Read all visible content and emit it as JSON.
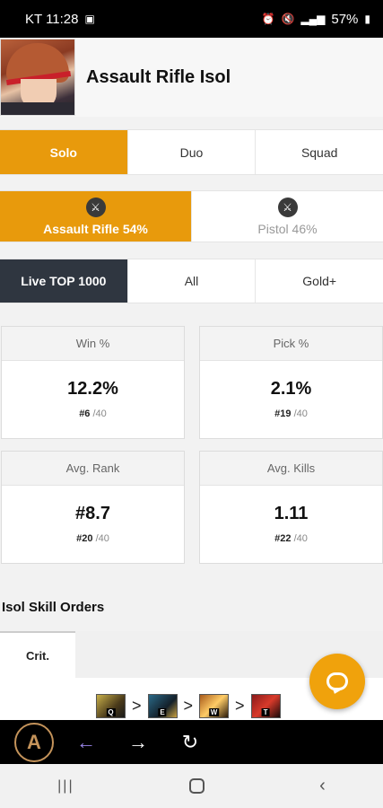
{
  "status": {
    "carrier_time": "KT 11:28",
    "battery": "57%"
  },
  "header": {
    "title": "Assault Rifle Isol"
  },
  "mode_tabs": [
    {
      "label": "Solo",
      "active": true
    },
    {
      "label": "Duo",
      "active": false
    },
    {
      "label": "Squad",
      "active": false
    }
  ],
  "weapon_tabs": [
    {
      "label": "Assault Rifle 54%",
      "icon": "assault-rifle-icon",
      "active": true
    },
    {
      "label": "Pistol 46%",
      "icon": "pistol-icon",
      "active": false
    }
  ],
  "tier_tabs": [
    {
      "label": "Live TOP 1000",
      "active": true
    },
    {
      "label": "All",
      "active": false
    },
    {
      "label": "Gold+",
      "active": false
    }
  ],
  "stats": [
    {
      "label": "Win %",
      "value": "12.2%",
      "rank": "#6",
      "total": "/40"
    },
    {
      "label": "Pick %",
      "value": "2.1%",
      "rank": "#19",
      "total": "/40"
    },
    {
      "label": "Avg. Rank",
      "value": "#8.7",
      "rank": "#20",
      "total": "/40"
    },
    {
      "label": "Avg. Kills",
      "value": "1.11",
      "rank": "#22",
      "total": "/40"
    }
  ],
  "skill_orders": {
    "title": "Isol Skill Orders",
    "tab": "Crit.",
    "sequence": [
      {
        "key": "Q",
        "icon": "skill-q-icon"
      },
      {
        "key": "E",
        "icon": "skill-e-icon"
      },
      {
        "key": "W",
        "icon": "skill-w-icon"
      },
      {
        "key": "T",
        "icon": "skill-t-icon"
      }
    ],
    "separator": ">"
  },
  "colors": {
    "accent": "#e89a0c",
    "dark_tab": "#2f3640",
    "back_arrow": "#9a86e8"
  }
}
